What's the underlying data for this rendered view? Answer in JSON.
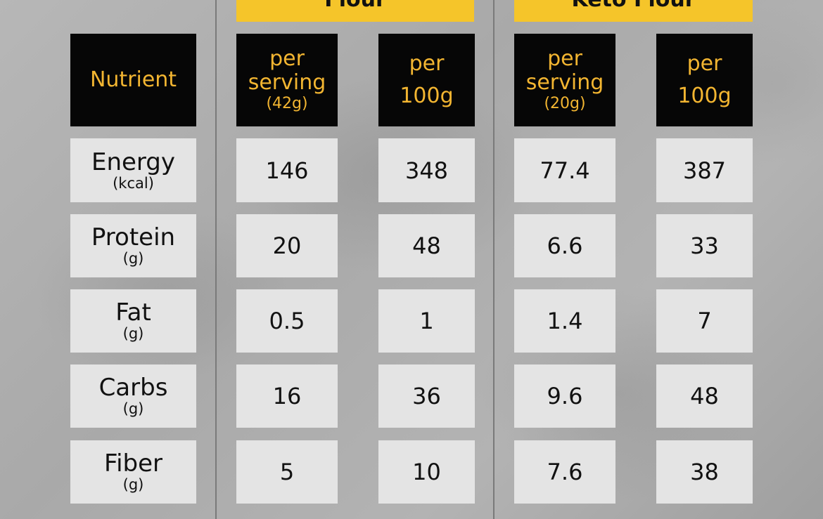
{
  "groups": [
    {
      "title": "Flour"
    },
    {
      "title": "Keto Flour"
    }
  ],
  "header": {
    "nutrient_label": "Nutrient",
    "col1": {
      "line1": "per",
      "line2": "serving",
      "sub": "(42g)"
    },
    "col2": {
      "line1": "per",
      "line2": "100g"
    },
    "col3": {
      "line1": "per",
      "line2": "serving",
      "sub": "(20g)"
    },
    "col4": {
      "line1": "per",
      "line2": "100g"
    }
  },
  "rows": [
    {
      "name": "Energy",
      "unit": "(kcal)",
      "values": [
        "146",
        "348",
        "77.4",
        "387"
      ]
    },
    {
      "name": "Protein",
      "unit": "(g)",
      "values": [
        "20",
        "48",
        "6.6",
        "33"
      ]
    },
    {
      "name": "Fat",
      "unit": "(g)",
      "values": [
        "0.5",
        "1",
        "1.4",
        "7"
      ]
    },
    {
      "name": "Carbs",
      "unit": "(g)",
      "values": [
        "16",
        "36",
        "9.6",
        "48"
      ]
    },
    {
      "name": "Fiber",
      "unit": "(g)",
      "values": [
        "5",
        "10",
        "7.6",
        "38"
      ]
    }
  ],
  "colors": {
    "accent_yellow": "#f5c52a",
    "header_black": "#060606",
    "header_text": "#f2b531",
    "cell_light": "#e4e4e4"
  }
}
